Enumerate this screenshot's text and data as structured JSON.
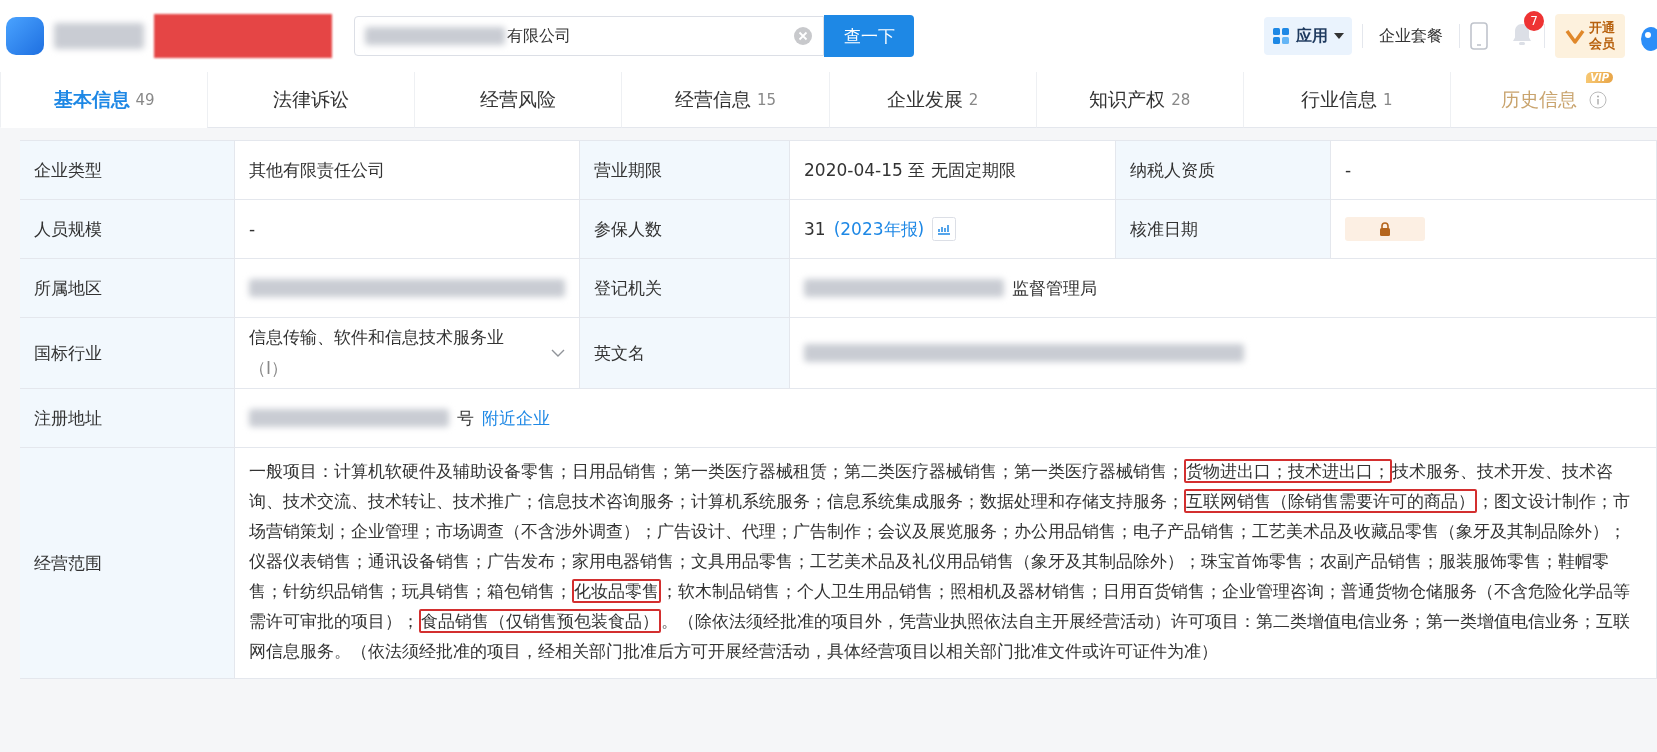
{
  "header": {
    "search": {
      "value": "有限公司",
      "redacted": true
    },
    "search_button": "查一下",
    "apps": "应用",
    "package": "企业套餐",
    "notifications": "7",
    "vip": [
      "开通",
      "会员"
    ]
  },
  "tabs": [
    {
      "label": "基本信息",
      "count": "49",
      "selected": true,
      "vip": false
    },
    {
      "label": "法律诉讼",
      "selected": false,
      "vip": false
    },
    {
      "label": "经营风险",
      "selected": false,
      "vip": false
    },
    {
      "label": "经营信息",
      "count": "15",
      "selected": false,
      "vip": false
    },
    {
      "label": "企业发展",
      "count": "2",
      "selected": false,
      "vip": false
    },
    {
      "label": "知识产权",
      "count": "28",
      "selected": false,
      "vip": false
    },
    {
      "label": "行业信息",
      "count": "1",
      "selected": false,
      "vip": false
    },
    {
      "label": "历史信息",
      "selected": false,
      "vip": true,
      "badge": "VIP"
    }
  ],
  "rows": [
    {
      "cells": [
        {
          "label": "企业类型",
          "value": "其他有限责任公司"
        },
        {
          "label": "营业期限",
          "value": "2020-04-15 至 无固定期限"
        },
        {
          "label": "纳税人资质",
          "value": "-"
        }
      ]
    },
    {
      "cells": [
        {
          "label": "人员规模",
          "value": "-"
        },
        {
          "label": "参保人数",
          "value": "31",
          "link": "(2023年报)",
          "trend": true
        },
        {
          "label": "核准日期",
          "locked": true
        }
      ]
    },
    {
      "cells": [
        {
          "label": "所属地区",
          "redacted": true
        },
        {
          "label": "登记机关",
          "redacted": true,
          "value": "监督管理局"
        }
      ]
    },
    {
      "cells": [
        {
          "label": "国标行业",
          "value": "信息传输、软件和信息技术服务业",
          "sub": "（I）",
          "expandable": true
        },
        {
          "label": "英文名",
          "redacted": true
        }
      ]
    },
    {
      "cells": [
        {
          "label": "注册地址",
          "redacted": true,
          "value": "号",
          "link": "附近企业"
        }
      ]
    }
  ],
  "scope": {
    "label": "经营范围",
    "segments": [
      {
        "text": "一般项目：计算机软硬件及辅助设备零售；日用品销售；第一类医疗器械租赁；第二类医疗器械销售；第一类医疗器械销售；",
        "highlighted": false
      },
      {
        "text": "货物进出口；技术进出口；",
        "highlighted": true
      },
      {
        "text": "技术服务、技术开发、技术咨询、技术交流、技术转让、技术推广；信息技术咨询服务；计算机系统服务；信息系统集成服务；数据处理和存储支持服务；",
        "highlighted": false
      },
      {
        "text": "互联网销售（除销售需要许可的商品）",
        "highlighted": true
      },
      {
        "text": "；图文设计制作；市场营销策划；企业管理；市场调查（不含涉外调查）；广告设计、代理；广告制作；会议及展览服务；办公用品销售；电子产品销售；工艺美术品及收藏品零售（象牙及其制品除外）；仪器仪表销售；通讯设备销售；广告发布；家用电器销售；文具用品零售；工艺美术品及礼仪用品销售（象牙及其制品除外）；珠宝首饰零售；农副产品销售；服装服饰零售；鞋帽零售；针纺织品销售；玩具销售；箱包销售；",
        "highlighted": false
      },
      {
        "text": "化妆品零售",
        "highlighted": true
      },
      {
        "text": "；软木制品销售；个人卫生用品销售；照相机及器材销售；日用百货销售；企业管理咨询；普通货物仓储服务（不含危险化学品等需许可审批的项目）；",
        "highlighted": false
      },
      {
        "text": "食品销售（仅销售预包装食品）",
        "highlighted": true
      },
      {
        "text": "。（除依法须经批准的项目外，凭营业执照依法自主开展经营活动）许可项目：第二类增值电信业务；第一类增值电信业务；互联网信息服务。（依法须经批准的项目，经相关部门批准后方可开展经营活动，具体经营项目以相关部门批准文件或许可证件为准）",
        "highlighted": false
      }
    ]
  }
}
